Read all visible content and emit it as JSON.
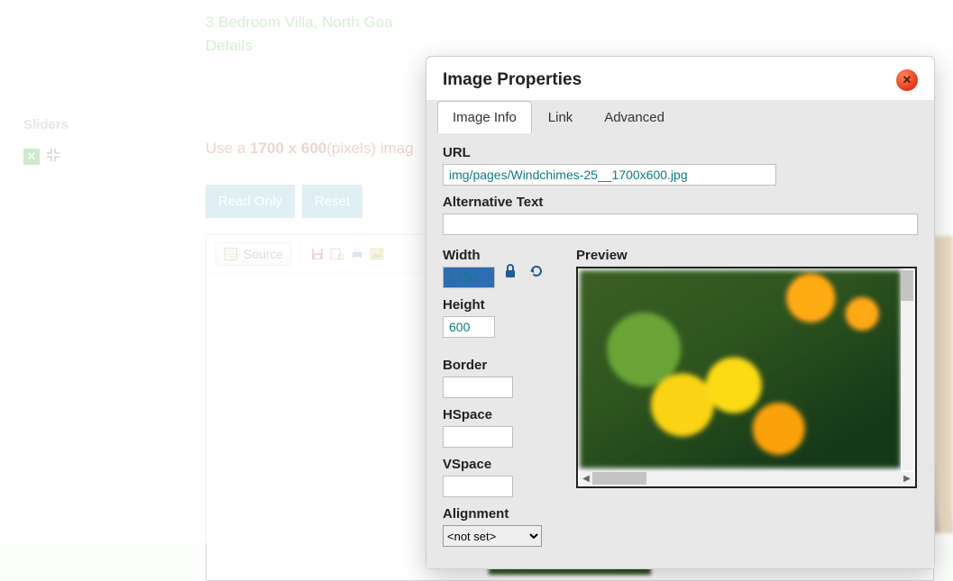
{
  "sidebar": {
    "heading": "Sliders"
  },
  "main": {
    "villa_line1": "3 Bedroom Villa, North Goa",
    "villa_line2": "Details",
    "hint_prefix": "Use a ",
    "hint_bold": "1700 x 600",
    "hint_suffix": "(pixels) imag",
    "readonly_label": "Read Only",
    "reset_label": "Reset",
    "source_label": "Source"
  },
  "dialog": {
    "title": "Image Properties",
    "tabs": {
      "image_info": "Image Info",
      "link": "Link",
      "advanced": "Advanced"
    },
    "labels": {
      "url": "URL",
      "alt": "Alternative Text",
      "width": "Width",
      "height": "Height",
      "border": "Border",
      "hspace": "HSpace",
      "vspace": "VSpace",
      "alignment": "Alignment",
      "preview": "Preview"
    },
    "values": {
      "url": "img/pages/Windchimes-25__1700x600.jpg",
      "alt": "",
      "width": "1700",
      "height": "600",
      "border": "",
      "hspace": "",
      "vspace": "",
      "alignment": "<not set>"
    }
  }
}
